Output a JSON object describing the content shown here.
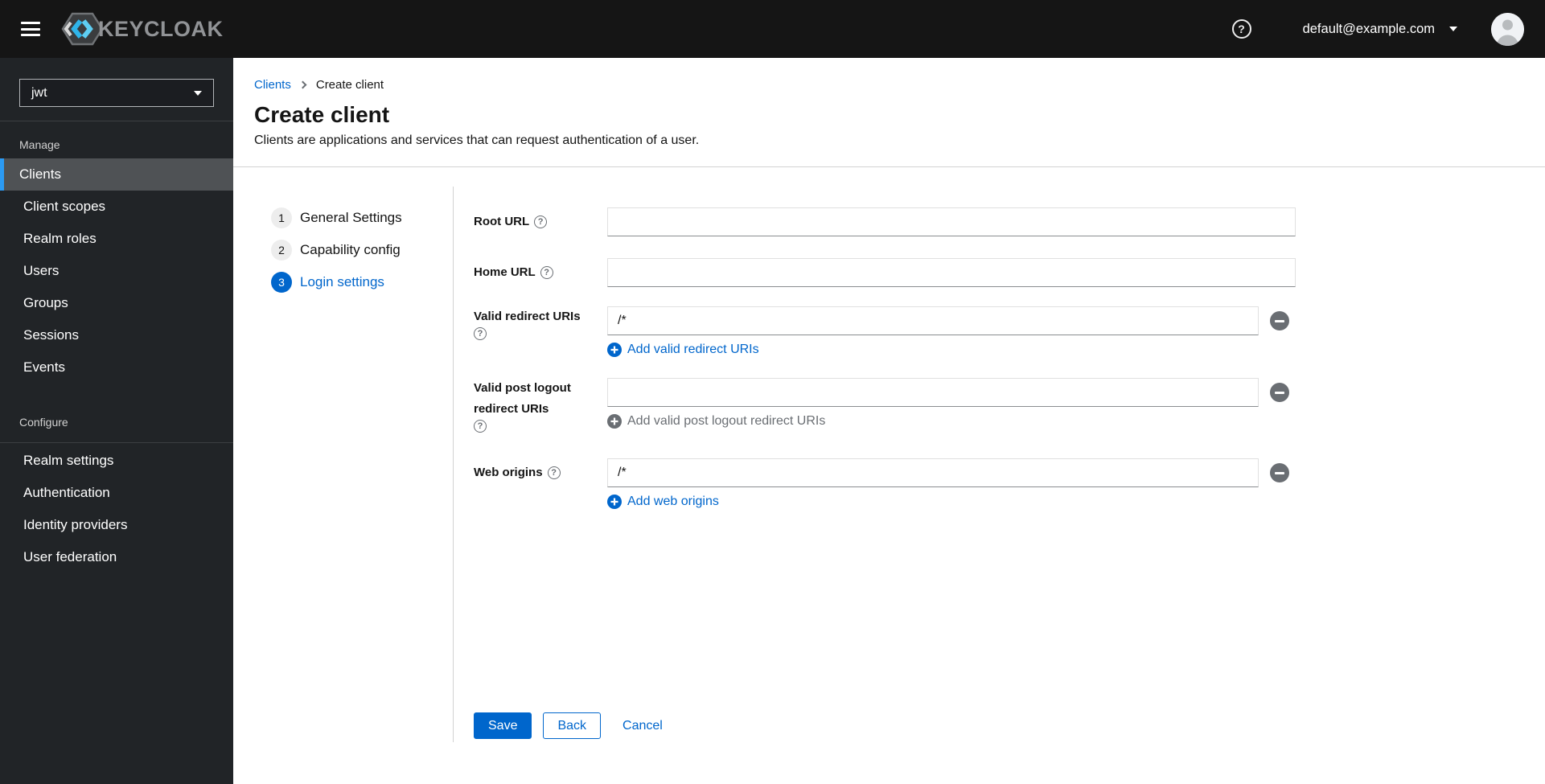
{
  "masthead": {
    "brand": "KEYCLOAK",
    "user_email": "default@example.com"
  },
  "sidebar": {
    "realm_selector": {
      "value": "jwt"
    },
    "sections": [
      {
        "label": "Manage",
        "items": [
          {
            "label": "Clients",
            "active": true
          },
          {
            "label": "Client scopes",
            "active": false
          },
          {
            "label": "Realm roles",
            "active": false
          },
          {
            "label": "Users",
            "active": false
          },
          {
            "label": "Groups",
            "active": false
          },
          {
            "label": "Sessions",
            "active": false
          },
          {
            "label": "Events",
            "active": false
          }
        ]
      },
      {
        "label": "Configure",
        "items": [
          {
            "label": "Realm settings",
            "active": false
          },
          {
            "label": "Authentication",
            "active": false
          },
          {
            "label": "Identity providers",
            "active": false
          },
          {
            "label": "User federation",
            "active": false
          }
        ]
      }
    ]
  },
  "breadcrumb": {
    "parent": "Clients",
    "current": "Create client"
  },
  "page_header": {
    "title": "Create client",
    "subtitle": "Clients are applications and services that can request authentication of a user."
  },
  "wizard": {
    "steps": [
      {
        "number": "1",
        "label": "General Settings",
        "current": false
      },
      {
        "number": "2",
        "label": "Capability config",
        "current": false
      },
      {
        "number": "3",
        "label": "Login settings",
        "current": true
      }
    ]
  },
  "form": {
    "fields": [
      {
        "label": "Root URL",
        "value": ""
      },
      {
        "label": "Home URL",
        "value": ""
      },
      {
        "label": "Valid redirect URIs",
        "value": "/*",
        "add_label": "Add valid redirect URIs",
        "add_enabled": true
      },
      {
        "label": "Valid post logout redirect URIs",
        "value": "",
        "add_label": "Add valid post logout redirect URIs",
        "add_enabled": false
      },
      {
        "label": "Web origins",
        "value": "/*",
        "add_label": "Add web origins",
        "add_enabled": true
      }
    ],
    "actions": {
      "save": "Save",
      "back": "Back",
      "cancel": "Cancel"
    }
  },
  "colors": {
    "primary": "#0066cc",
    "masthead_bg": "#151515",
    "sidebar_bg": "#212427",
    "nav_active_bg": "#4f5255",
    "nav_active_indicator": "#2b9af3",
    "icon_gray": "#6a6e73",
    "logo_cyan": "#2fb4e9"
  }
}
